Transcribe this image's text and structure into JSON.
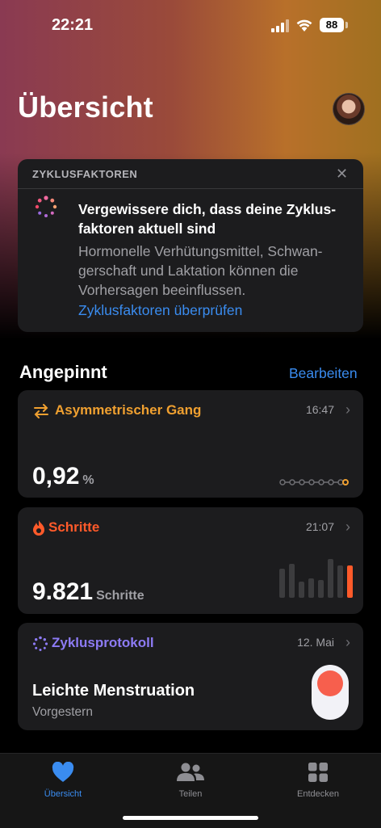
{
  "status_bar": {
    "time": "22:21",
    "battery": "88"
  },
  "header": {
    "title": "Übersicht"
  },
  "cycle_factors": {
    "label": "ZYKLUSFAKTOREN",
    "title": "Vergewissere dich, dass deine Zyklus-faktoren aktuell sind",
    "body": "Hormonelle Verhütungsmittel, Schwan-gerschaft und Laktation können die Vorhersagen beeinflussen.",
    "link": "Zyklusfaktoren überprüfen"
  },
  "pinned": {
    "title": "Angepinnt",
    "edit_label": "Bearbeiten"
  },
  "gait": {
    "title": "Asymmetrischer Gang",
    "time": "16:47",
    "value": "0,92",
    "unit": "%",
    "accent": "#f0a030"
  },
  "steps": {
    "title": "Schritte",
    "time": "21:07",
    "value": "9.821",
    "unit": "Schritte",
    "accent": "#ff5a2a"
  },
  "cycle_log": {
    "title": "Zyklusprotokoll",
    "date": "12. Mai",
    "entry": "Leichte Menstruation",
    "when": "Vorgestern",
    "accent": "#8d7bf5"
  },
  "tabs": [
    {
      "label": "Übersicht",
      "icon": "heart-icon",
      "active": true
    },
    {
      "label": "Teilen",
      "icon": "people-icon",
      "active": false
    },
    {
      "label": "Entdecken",
      "icon": "grid-icon",
      "active": false
    }
  ],
  "colors": {
    "link": "#3a8cf0",
    "card": "#1c1c1e",
    "active_tab": "#3a8cf0"
  }
}
